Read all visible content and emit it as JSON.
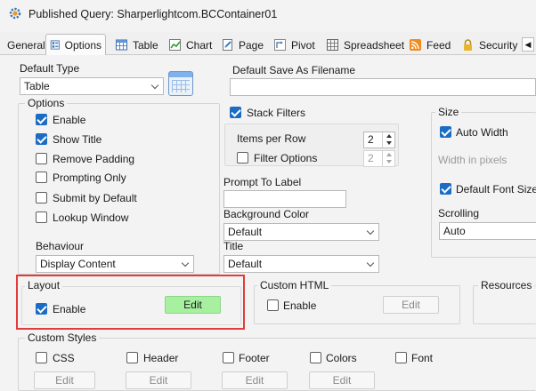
{
  "window": {
    "title": "Published Query: Sharperlightcom.BCContainer01"
  },
  "tabs": [
    {
      "label": "General",
      "icon": "none",
      "active": false
    },
    {
      "label": "Options",
      "icon": "options-icon",
      "active": true
    },
    {
      "label": "Table",
      "icon": "table-icon",
      "active": false
    },
    {
      "label": "Chart",
      "icon": "chart-icon",
      "active": false
    },
    {
      "label": "Page",
      "icon": "page-icon",
      "active": false
    },
    {
      "label": "Pivot",
      "icon": "pivot-icon",
      "active": false
    },
    {
      "label": "Spreadsheet",
      "icon": "spreadsheet-icon",
      "active": false
    },
    {
      "label": "Feed",
      "icon": "rss-feed-icon",
      "active": false
    },
    {
      "label": "Security",
      "icon": "lock-icon",
      "active": false
    }
  ],
  "default_type": {
    "label": "Default Type",
    "value": "Table"
  },
  "default_filename": {
    "label": "Default Save As Filename",
    "value": ""
  },
  "options": {
    "label": "Options",
    "checkboxes": [
      {
        "label": "Enable",
        "checked": true
      },
      {
        "label": "Show Title",
        "checked": true
      },
      {
        "label": "Remove Padding",
        "checked": false
      },
      {
        "label": "Prompting Only",
        "checked": false
      },
      {
        "label": "Submit by Default",
        "checked": false
      },
      {
        "label": "Lookup Window",
        "checked": false
      }
    ],
    "behaviour": {
      "label": "Behaviour",
      "value": "Display Content"
    }
  },
  "stack_filters": {
    "label": "Stack Filters",
    "checked": true
  },
  "items_per_row": {
    "label": "Items per Row",
    "value": "2"
  },
  "filter_options": {
    "label": "Filter Options",
    "checked": false,
    "value": "2"
  },
  "prompt_to_label": {
    "label": "Prompt To Label",
    "value": ""
  },
  "background_color": {
    "label": "Background Color",
    "value": "Default"
  },
  "title_field": {
    "label": "Title",
    "value": "Default"
  },
  "size": {
    "label": "Size",
    "auto_width": {
      "label": "Auto Width",
      "checked": true
    },
    "width_pixels_label": "Width in pixels",
    "default_font_size": {
      "label": "Default Font Size",
      "checked": true
    },
    "scrolling": {
      "label": "Scrolling",
      "value": "Auto"
    }
  },
  "layout": {
    "label": "Layout",
    "enable_label": "Enable",
    "enabled": true,
    "edit_label": "Edit"
  },
  "custom_html": {
    "label": "Custom HTML",
    "enable_label": "Enable",
    "enabled": false,
    "edit_label": "Edit"
  },
  "resources": {
    "label": "Resources"
  },
  "custom_styles": {
    "label": "Custom Styles",
    "items": [
      {
        "label": "CSS",
        "checked": false,
        "edit_label": "Edit"
      },
      {
        "label": "Header",
        "checked": false,
        "edit_label": "Edit"
      },
      {
        "label": "Footer",
        "checked": false,
        "edit_label": "Edit"
      },
      {
        "label": "Colors",
        "checked": false,
        "edit_label": "Edit"
      },
      {
        "label": "Font",
        "checked": false,
        "edit_label": ""
      }
    ]
  },
  "colors": {
    "accent": "#1c6cc4",
    "highlight_border": "#e23b3b",
    "edit_green": "#a6f0a0"
  }
}
